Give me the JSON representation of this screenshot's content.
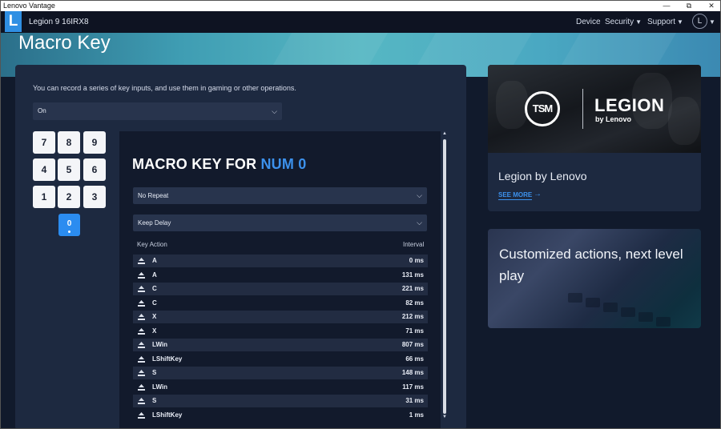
{
  "window": {
    "title": "Lenovo Vantage",
    "controls": [
      "—",
      "⧉",
      "✕"
    ]
  },
  "app": {
    "logo": "L",
    "device_name": "Legion 9 16IRX8",
    "nav": [
      {
        "label": "Device",
        "has_menu": false
      },
      {
        "label": "Security",
        "has_menu": true
      },
      {
        "label": "Support",
        "has_menu": true
      }
    ],
    "avatar": "L"
  },
  "page": {
    "title": "Macro Key",
    "description": "You can record a series of key inputs, and use them in gaming or other operations.",
    "state_dropdown": "On"
  },
  "keypad": {
    "keys": [
      "7",
      "8",
      "9",
      "4",
      "5",
      "6",
      "1",
      "2",
      "3"
    ],
    "selected_key": "0"
  },
  "macro": {
    "title_prefix": "MACRO KEY FOR",
    "title_key": "NUM 0",
    "repeat_dropdown": "No Repeat",
    "delay_dropdown": "Keep Delay",
    "col_action": "Key Action",
    "col_interval": "Interval",
    "rows": [
      {
        "key": "A",
        "interval": "0 ms"
      },
      {
        "key": "A",
        "interval": "131 ms"
      },
      {
        "key": "C",
        "interval": "221 ms"
      },
      {
        "key": "C",
        "interval": "82 ms"
      },
      {
        "key": "X",
        "interval": "212 ms"
      },
      {
        "key": "X",
        "interval": "71 ms"
      },
      {
        "key": "LWin",
        "interval": "807 ms"
      },
      {
        "key": "LShiftKey",
        "interval": "66 ms"
      },
      {
        "key": "S",
        "interval": "148 ms"
      },
      {
        "key": "LWin",
        "interval": "117 ms"
      },
      {
        "key": "S",
        "interval": "31 ms"
      },
      {
        "key": "LShiftKey",
        "interval": "1 ms"
      }
    ]
  },
  "promo1": {
    "logo_left": "TSM",
    "brand": "LEGION",
    "brand_sub": "by Lenovo",
    "title": "Legion by Lenovo",
    "link": "SEE MORE"
  },
  "promo2": {
    "title": "Customized actions, next level play"
  },
  "colors": {
    "accent": "#3c91ec",
    "selected_key": "#2b8cf0",
    "card_bg": "#1d2940"
  }
}
